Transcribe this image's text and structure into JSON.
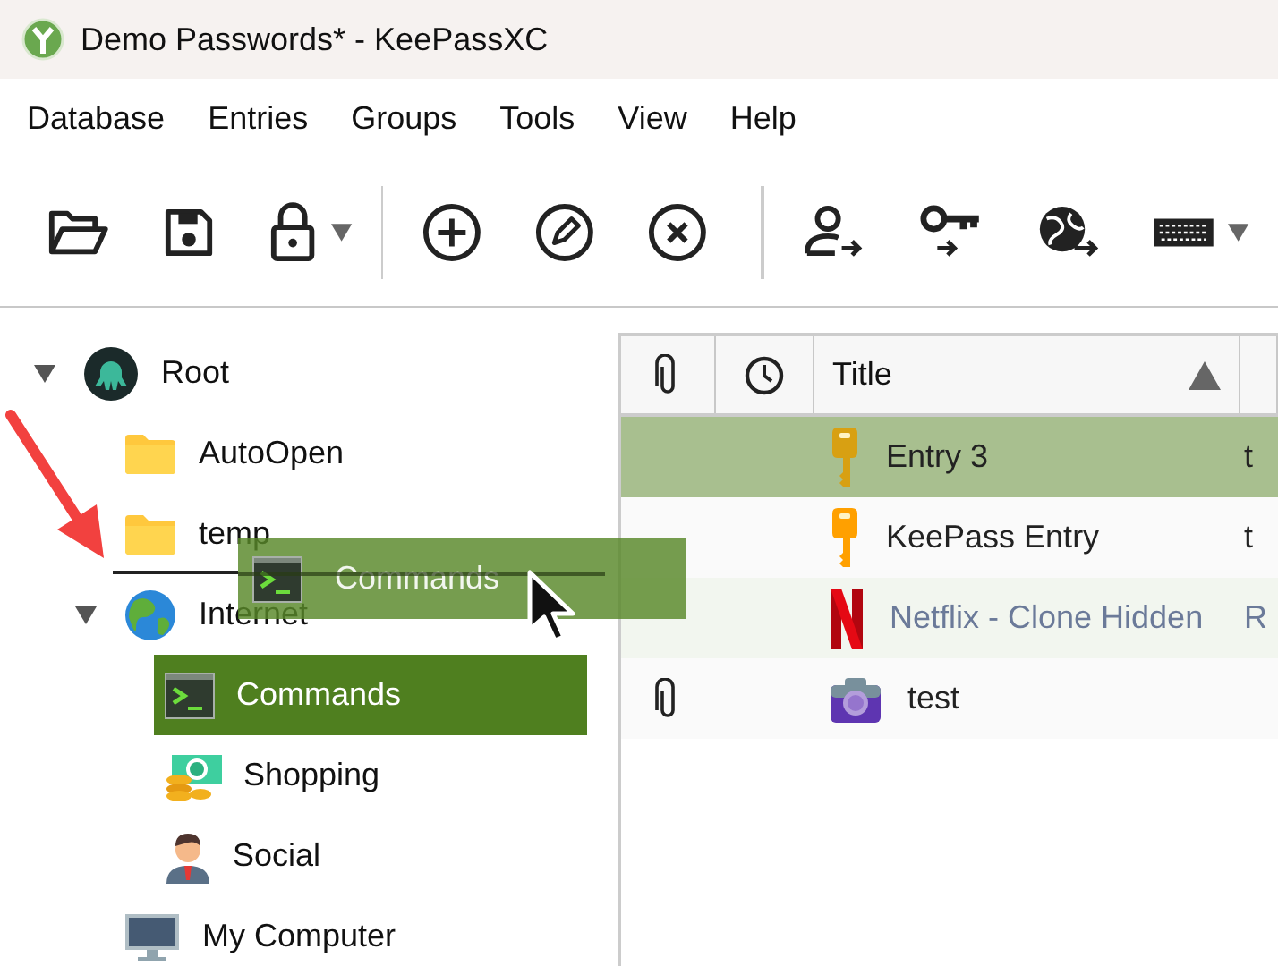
{
  "window": {
    "title": "Demo Passwords* - KeePassXC"
  },
  "menu": [
    "Database",
    "Entries",
    "Groups",
    "Tools",
    "View",
    "Help"
  ],
  "tree": [
    {
      "label": "Root",
      "kind": "root",
      "expanded": true,
      "selected": false,
      "children": [
        {
          "label": "AutoOpen",
          "kind": "folder",
          "selected": false
        },
        {
          "label": "temp",
          "kind": "folder",
          "selected": false
        },
        {
          "label": "Internet",
          "kind": "globe",
          "expanded": true,
          "selected": false,
          "children": [
            {
              "label": "Commands",
              "kind": "terminal",
              "selected": true
            },
            {
              "label": "Shopping",
              "kind": "money",
              "selected": false
            },
            {
              "label": "Social",
              "kind": "person",
              "selected": false
            }
          ]
        },
        {
          "label": "My Computer",
          "kind": "computer",
          "selected": false
        }
      ]
    }
  ],
  "drag": {
    "label": "Commands",
    "kind": "terminal"
  },
  "table": {
    "columns": [
      {
        "kind": "attachment"
      },
      {
        "kind": "clock"
      },
      {
        "kind": "text",
        "label": "Title",
        "sorted_ascending": true
      }
    ],
    "rows": [
      {
        "attachment": false,
        "kind": "key",
        "title": "Entry 3",
        "column_4": "t",
        "selected": true,
        "expired": false
      },
      {
        "attachment": false,
        "kind": "key",
        "title": "KeePass Entry",
        "column_4": "t",
        "selected": false,
        "expired": false
      },
      {
        "attachment": false,
        "kind": "ribbon",
        "title": "Netflix - Clone Hidden",
        "column_4": "R",
        "selected": false,
        "expired": true
      },
      {
        "attachment": true,
        "kind": "camera",
        "title": "test",
        "selected": false,
        "expired": false
      }
    ]
  }
}
